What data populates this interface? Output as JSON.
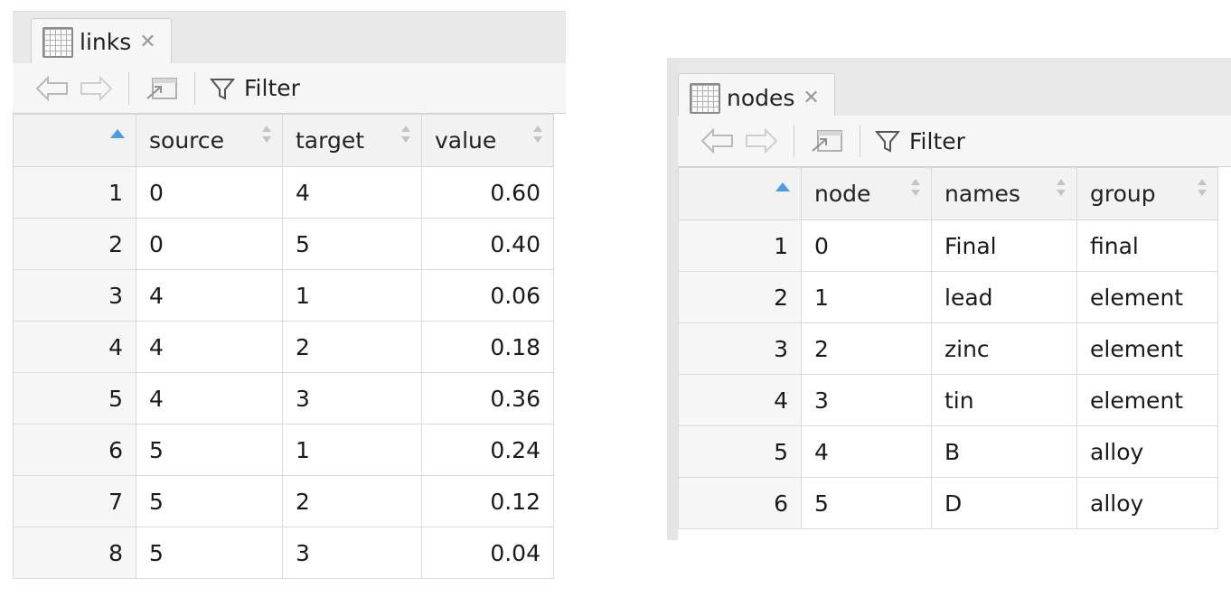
{
  "links_panel": {
    "tab_label": "links",
    "filter_label": "Filter",
    "columns": [
      "source",
      "target",
      "value"
    ],
    "rows": [
      {
        "row": "1",
        "source": "0",
        "target": "4",
        "value": "0.60"
      },
      {
        "row": "2",
        "source": "0",
        "target": "5",
        "value": "0.40"
      },
      {
        "row": "3",
        "source": "4",
        "target": "1",
        "value": "0.06"
      },
      {
        "row": "4",
        "source": "4",
        "target": "2",
        "value": "0.18"
      },
      {
        "row": "5",
        "source": "4",
        "target": "3",
        "value": "0.36"
      },
      {
        "row": "6",
        "source": "5",
        "target": "1",
        "value": "0.24"
      },
      {
        "row": "7",
        "source": "5",
        "target": "2",
        "value": "0.12"
      },
      {
        "row": "8",
        "source": "5",
        "target": "3",
        "value": "0.04"
      }
    ]
  },
  "nodes_panel": {
    "tab_label": "nodes",
    "filter_label": "Filter",
    "columns": [
      "node",
      "names",
      "group"
    ],
    "rows": [
      {
        "row": "1",
        "node": "0",
        "names": "Final",
        "group": "final"
      },
      {
        "row": "2",
        "node": "1",
        "names": "lead",
        "group": "element"
      },
      {
        "row": "3",
        "node": "2",
        "names": "zinc",
        "group": "element"
      },
      {
        "row": "4",
        "node": "3",
        "names": "tin",
        "group": "element"
      },
      {
        "row": "5",
        "node": "4",
        "names": "B",
        "group": "alloy"
      },
      {
        "row": "6",
        "node": "5",
        "names": "D",
        "group": "alloy"
      }
    ]
  },
  "icons": {
    "tab": "data-grid-icon",
    "close": "close-icon",
    "back": "back-arrow-icon",
    "forward": "forward-arrow-icon",
    "popout": "popout-window-icon",
    "filter": "filter-funnel-icon",
    "sort": "sort-arrows-icon",
    "row_sort": "sort-ascending-icon"
  },
  "colors": {
    "sort_active": "#4a9ce8",
    "grid_border": "#d8d8d8",
    "header_bg": "#f2f2f2"
  }
}
